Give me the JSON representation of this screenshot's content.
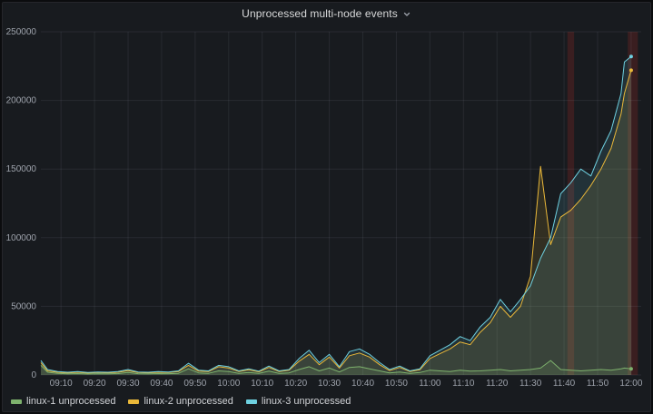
{
  "panel": {
    "title": "Unprocessed multi-node events",
    "menu_icon": "chevron-down"
  },
  "chart_data": {
    "type": "line",
    "title": "Unprocessed multi-node events",
    "xlabel": "",
    "ylabel": "",
    "xlim": [
      "09:04",
      "12:03"
    ],
    "ylim": [
      0,
      250000
    ],
    "grid": true,
    "legend_position": "bottom-left",
    "fill_opacity": 0.13,
    "x_ticks": [
      "09:10",
      "09:20",
      "09:30",
      "09:40",
      "09:50",
      "10:00",
      "10:10",
      "10:20",
      "10:30",
      "10:40",
      "10:50",
      "11:00",
      "11:10",
      "11:20",
      "11:30",
      "11:40",
      "11:50",
      "12:00"
    ],
    "y_ticks": [
      0,
      50000,
      100000,
      150000,
      200000,
      250000
    ],
    "x": [
      "09:04",
      "09:06",
      "09:09",
      "09:12",
      "09:15",
      "09:18",
      "09:21",
      "09:24",
      "09:27",
      "09:30",
      "09:33",
      "09:36",
      "09:39",
      "09:42",
      "09:45",
      "09:48",
      "09:51",
      "09:54",
      "09:57",
      "10:00",
      "10:03",
      "10:06",
      "10:09",
      "10:12",
      "10:15",
      "10:18",
      "10:21",
      "10:24",
      "10:27",
      "10:30",
      "10:33",
      "10:36",
      "10:39",
      "10:42",
      "10:45",
      "10:48",
      "10:51",
      "10:54",
      "10:57",
      "11:00",
      "11:03",
      "11:06",
      "11:09",
      "11:12",
      "11:15",
      "11:18",
      "11:21",
      "11:24",
      "11:27",
      "11:30",
      "11:33",
      "11:36",
      "11:39",
      "11:42",
      "11:45",
      "11:48",
      "11:51",
      "11:54",
      "11:57",
      "11:58",
      "12:00"
    ],
    "series": [
      {
        "name": "linux-1 unprocessed",
        "color": "#7EB26D",
        "values": [
          7000,
          2000,
          1200,
          800,
          1000,
          700,
          900,
          800,
          1000,
          1800,
          900,
          800,
          1000,
          900,
          1200,
          4500,
          1500,
          1200,
          3000,
          2500,
          1200,
          1800,
          1100,
          2800,
          1200,
          1500,
          4000,
          6000,
          3000,
          5000,
          2200,
          5500,
          6000,
          4500,
          3000,
          1500,
          2200,
          1200,
          1800,
          3500,
          3000,
          2500,
          3500,
          2800,
          3000,
          3500,
          4000,
          3000,
          3500,
          4000,
          5000,
          10500,
          4000,
          3500,
          3000,
          3500,
          4000,
          3500,
          4500,
          5000,
          4500
        ]
      },
      {
        "name": "linux-2 unprocessed",
        "color": "#EAB839",
        "values": [
          9000,
          3000,
          2000,
          1500,
          2000,
          1400,
          1800,
          1600,
          2000,
          3200,
          1800,
          1600,
          2000,
          1800,
          2500,
          7000,
          2800,
          2500,
          6000,
          5000,
          2500,
          3800,
          2300,
          5500,
          2500,
          3500,
          10000,
          15000,
          7500,
          13000,
          5000,
          14000,
          16000,
          13000,
          7500,
          3200,
          5500,
          2500,
          3800,
          12000,
          15500,
          19000,
          24000,
          22000,
          31000,
          38000,
          50000,
          42000,
          50000,
          72000,
          152000,
          95000,
          115000,
          120000,
          128000,
          138000,
          150000,
          165000,
          190000,
          205000,
          222000
        ]
      },
      {
        "name": "linux-3 unprocessed",
        "color": "#6ED0E0",
        "values": [
          10500,
          4000,
          2500,
          2000,
          2500,
          1800,
          2200,
          2000,
          2500,
          4000,
          2200,
          2000,
          2500,
          2200,
          3000,
          8500,
          3500,
          3000,
          7000,
          6000,
          3000,
          4500,
          2800,
          6500,
          3000,
          4000,
          12000,
          18000,
          9000,
          15000,
          6000,
          17000,
          19000,
          15000,
          9000,
          4000,
          6500,
          3000,
          4500,
          14000,
          18000,
          22000,
          28000,
          25000,
          35000,
          42000,
          55000,
          46000,
          55000,
          65000,
          85000,
          100000,
          132000,
          140000,
          150000,
          145000,
          163000,
          178000,
          205000,
          228000,
          232000
        ]
      }
    ],
    "annotations": [
      {
        "from": "11:41",
        "to": "11:43",
        "color": "rgba(235,50,35,0.16)"
      },
      {
        "from": "11:59",
        "to": "12:02",
        "color": "rgba(235,50,35,0.16)"
      }
    ]
  },
  "style": {
    "grid_color": "rgba(204,204,220,0.09)",
    "axis_text_color": "#9da2ab"
  }
}
